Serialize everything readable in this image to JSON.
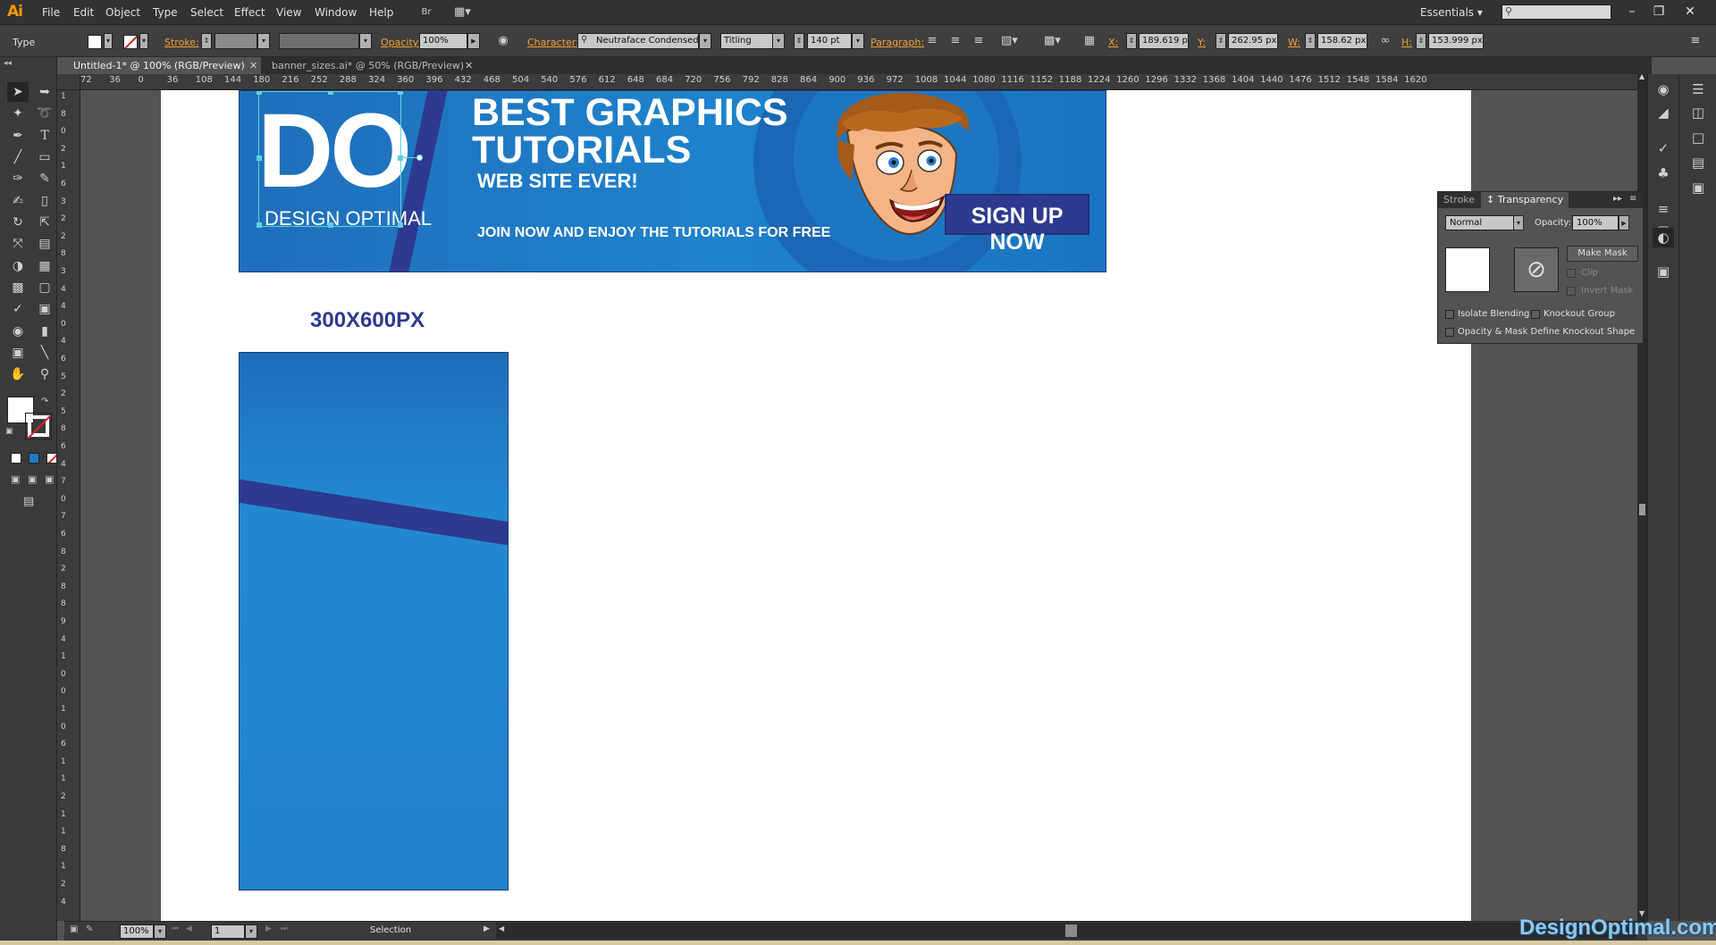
{
  "app": {
    "logo": "Ai"
  },
  "menu": [
    "File",
    "Edit",
    "Object",
    "Type",
    "Select",
    "Effect",
    "View",
    "Window",
    "Help"
  ],
  "workspace": {
    "label": "Essentials ▾"
  },
  "control_bar": {
    "tool_name": "Type",
    "stroke_label": "Stroke:",
    "opacity_label": "Opacity:",
    "opacity_value": "100%",
    "character_label": "Character:",
    "font_name": "Neutraface Condensed",
    "font_style": "Titling",
    "font_size": "140 pt",
    "paragraph_label": "Paragraph:",
    "x_label": "X:",
    "x_value": "189.619 px",
    "y_label": "Y:",
    "y_value": "262.95 px",
    "w_label": "W:",
    "w_value": "158.62 px",
    "h_label": "H:",
    "h_value": "153.999 px"
  },
  "tabs": [
    {
      "label": "Untitled-1* @ 100% (RGB/Preview)",
      "active": true
    },
    {
      "label": "banner_sizes.ai* @ 50% (RGB/Preview)",
      "active": false
    }
  ],
  "ruler_top": [
    "72",
    "36",
    "0",
    "36",
    "108",
    "144",
    "180",
    "216",
    "252",
    "288",
    "324",
    "360",
    "396",
    "432",
    "468",
    "504",
    "540",
    "576",
    "612",
    "648",
    "684",
    "720",
    "756",
    "792",
    "828",
    "864",
    "900",
    "936",
    "972",
    "1008",
    "1044",
    "1080",
    "1116",
    "1152",
    "1188",
    "1224",
    "1260",
    "1296",
    "1332",
    "1368",
    "1404",
    "1440",
    "1476",
    "1512",
    "1548",
    "1584",
    "1620"
  ],
  "ruler_left": [
    "1",
    "8",
    "0",
    "2",
    "1",
    "6",
    "3",
    "2",
    "2",
    "8",
    "3",
    "4",
    "4",
    "0",
    "4",
    "6",
    "5",
    "2",
    "5",
    "8",
    "6",
    "4",
    "7",
    "0",
    "7",
    "6",
    "8",
    "2",
    "8",
    "8",
    "9",
    "4",
    "1",
    "0",
    "0",
    "1",
    "0",
    "6",
    "1",
    "1",
    "2",
    "1",
    "1",
    "8",
    "1",
    "2",
    "4"
  ],
  "artwork": {
    "logo_big": "DO",
    "logo_small": "DESIGN OPTIMAL",
    "title_line1": "BEST GRAPHICS",
    "title_line2": "TUTORIALS",
    "title_line3": "WEB SITE EVER!",
    "cta_line": "JOIN NOW AND ENJOY THE TUTORIALS FOR FREE",
    "signup_button": "SIGN UP NOW",
    "size_label": "300X600PX"
  },
  "transparency_panel": {
    "tab_stroke": "Stroke",
    "tab_transparency": "↕ Transparency",
    "blend_mode": "Normal",
    "opacity_label": "Opacity:",
    "opacity_value": "100%",
    "make_mask": "Make Mask",
    "clip": "Clip",
    "invert_mask": "Invert Mask",
    "isolate_blending": "Isolate Blending",
    "knockout_group": "Knockout Group",
    "opacity_mask_define": "Opacity & Mask Define Knockout Shape"
  },
  "status_bar": {
    "zoom": "100%",
    "page": "1",
    "tool": "Selection"
  },
  "watermark": "DesignOptimal.com",
  "colors": {
    "accent_orange": "#f0a030",
    "banner_blue": "#1f82cc",
    "navy": "#2d3a8f"
  }
}
